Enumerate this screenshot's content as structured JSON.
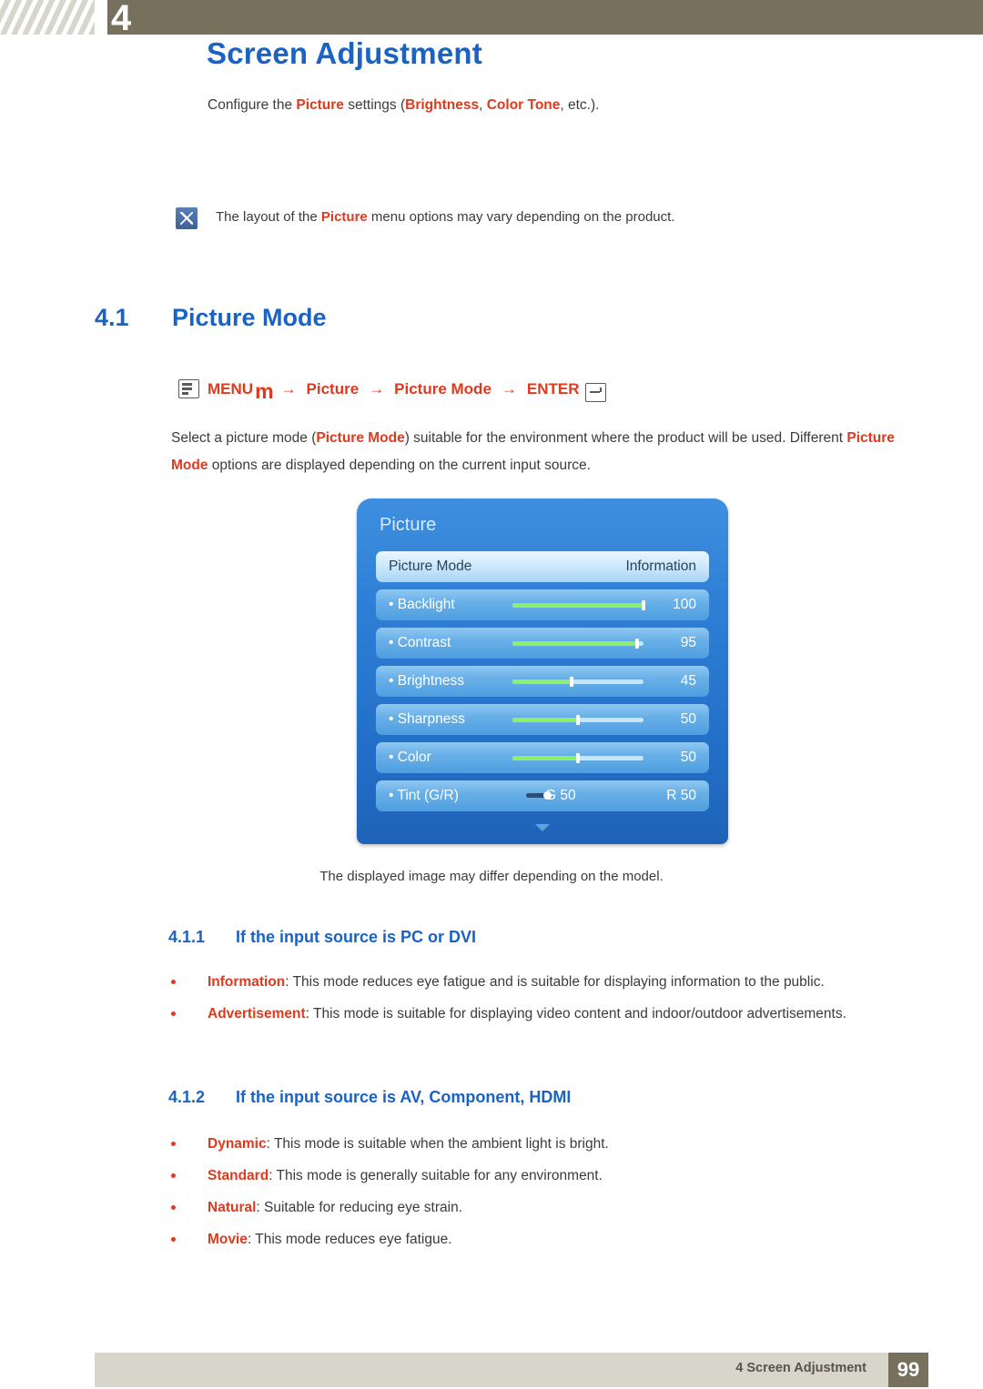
{
  "header": {
    "chapter_number": "4",
    "chapter_title": "Screen Adjustment",
    "intro_prefix": "Configure the ",
    "intro_picture": "Picture",
    "intro_mid": " settings (",
    "intro_brightness": "Brightness",
    "intro_comma": ", ",
    "intro_colortone": "Color Tone",
    "intro_suffix": ", etc.)."
  },
  "note": {
    "icon": "note-pencil-icon",
    "text_prefix": "The layout of the ",
    "text_keyword": "Picture",
    "text_suffix": " menu options may vary depending on the product."
  },
  "section": {
    "number": "4.1",
    "title": "Picture Mode"
  },
  "menu_path": {
    "menu_icon": "menu-button-icon",
    "menu_label": "MENU",
    "menu_m": "m",
    "arrow": "→",
    "step1": "Picture",
    "step2": "Picture Mode",
    "enter_label": "ENTER",
    "enter_icon": "enter-key-icon"
  },
  "body": {
    "line1_a": "Select a picture mode (",
    "line1_b": "Picture Mode",
    "line1_c": ") suitable for the environment where the product will be used. Different ",
    "line1_d": "Picture Mode",
    "line1_e": " options are displayed depending on the current input source."
  },
  "osd": {
    "title": "Picture",
    "rows": [
      {
        "label": "Picture Mode",
        "value": "Information",
        "type": "head"
      },
      {
        "label": "• Backlight",
        "value": "100",
        "type": "slider",
        "fill_pct": 100
      },
      {
        "label": "• Contrast",
        "value": "95",
        "type": "slider",
        "fill_pct": 95
      },
      {
        "label": "• Brightness",
        "value": "45",
        "type": "slider",
        "fill_pct": 45
      },
      {
        "label": "• Sharpness",
        "value": "50",
        "type": "slider",
        "fill_pct": 50
      },
      {
        "label": "• Color",
        "value": "50",
        "type": "slider",
        "fill_pct": 50
      },
      {
        "label": "• Tint (G/R)",
        "value": "R 50",
        "left_value": "G 50",
        "type": "tint"
      }
    ],
    "scroll_caret": "down-caret-icon",
    "caption": "The displayed image may differ depending on the model."
  },
  "subsection_1": {
    "number": "4.1.1",
    "title": "If the input source is PC or DVI",
    "bullets": [
      {
        "term": "Information",
        "text": ": This mode reduces eye fatigue and is suitable for displaying information to the public."
      },
      {
        "term": "Advertisement",
        "text": ": This mode is suitable for displaying video content and indoor/outdoor advertisements."
      }
    ]
  },
  "subsection_2": {
    "number": "4.1.2",
    "title": "If the input source is AV, Component, HDMI",
    "bullets": [
      {
        "term": "Dynamic",
        "text": ": This mode is suitable when the ambient light is bright."
      },
      {
        "term": "Standard",
        "text": ": This mode is generally suitable for any environment."
      },
      {
        "term": "Natural",
        "text": ": Suitable for reducing eye strain."
      },
      {
        "term": "Movie",
        "text": ": This mode reduces eye fatigue."
      }
    ]
  },
  "footer": {
    "text": "4 Screen Adjustment",
    "page": "99"
  },
  "colors": {
    "accent_blue": "#1a62c4",
    "accent_red": "#e03a1e",
    "band": "#76705c",
    "footer_band": "#d8d5cb"
  }
}
